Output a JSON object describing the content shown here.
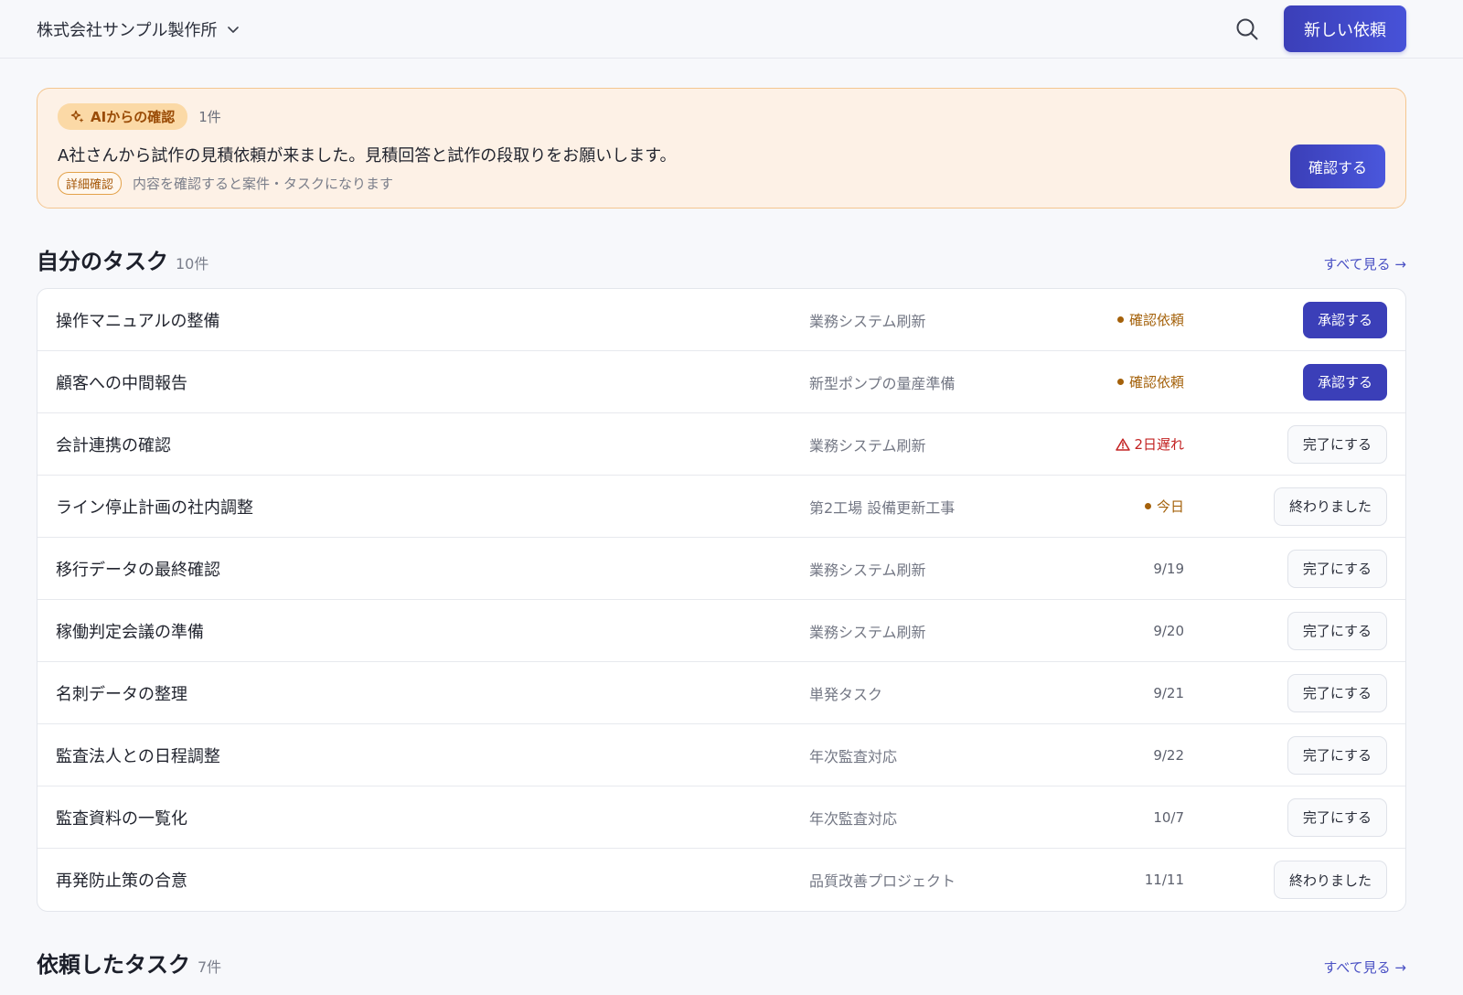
{
  "header": {
    "org_name": "株式会社サンプル製作所",
    "new_request_label": "新しい依頼"
  },
  "ai_card": {
    "badge_label": "AIからの確認",
    "count": "1件",
    "message": "A社さんから試作の見積依頼が来ました。見積回答と試作の段取りをお願いします。",
    "tag": "詳細確認",
    "hint": "内容を確認すると案件・タスクになります",
    "confirm_label": "確認する"
  },
  "my_tasks": {
    "title": "自分のタスク",
    "count": "10件",
    "see_all": "すべて見る →",
    "rows": [
      {
        "name": "操作マニュアルの整備",
        "project": "業務システム刷新",
        "status": "確認依頼",
        "action": "承認する"
      },
      {
        "name": "顧客への中間報告",
        "project": "新型ポンプの量産準備",
        "status": "確認依頼",
        "action": "承認する"
      },
      {
        "name": "会計連携の確認",
        "project": "業務システム刷新",
        "status": "2日遅れ",
        "action": "完了にする"
      },
      {
        "name": "ライン停止計画の社内調整",
        "project": "第2工場 設備更新工事",
        "status": "今日",
        "action": "終わりました"
      },
      {
        "name": "移行データの最終確認",
        "project": "業務システム刷新",
        "status": "9/19",
        "action": "完了にする"
      },
      {
        "name": "稼働判定会議の準備",
        "project": "業務システム刷新",
        "status": "9/20",
        "action": "完了にする"
      },
      {
        "name": "名刺データの整理",
        "project": "単発タスク",
        "status": "9/21",
        "action": "完了にする"
      },
      {
        "name": "監査法人との日程調整",
        "project": "年次監査対応",
        "status": "9/22",
        "action": "完了にする"
      },
      {
        "name": "監査資料の一覧化",
        "project": "年次監査対応",
        "status": "10/7",
        "action": "完了にする"
      },
      {
        "name": "再発防止策の合意",
        "project": "品質改善プロジェクト",
        "status": "11/11",
        "action": "終わりました"
      }
    ]
  },
  "requested_tasks": {
    "title": "依頼したタスク",
    "count": "7件",
    "see_all": "すべて見る →"
  },
  "colors": {
    "primary": "#3b3fb8",
    "warning": "#a4610a",
    "danger": "#c32323",
    "ai_bg": "#fdf1e6"
  }
}
